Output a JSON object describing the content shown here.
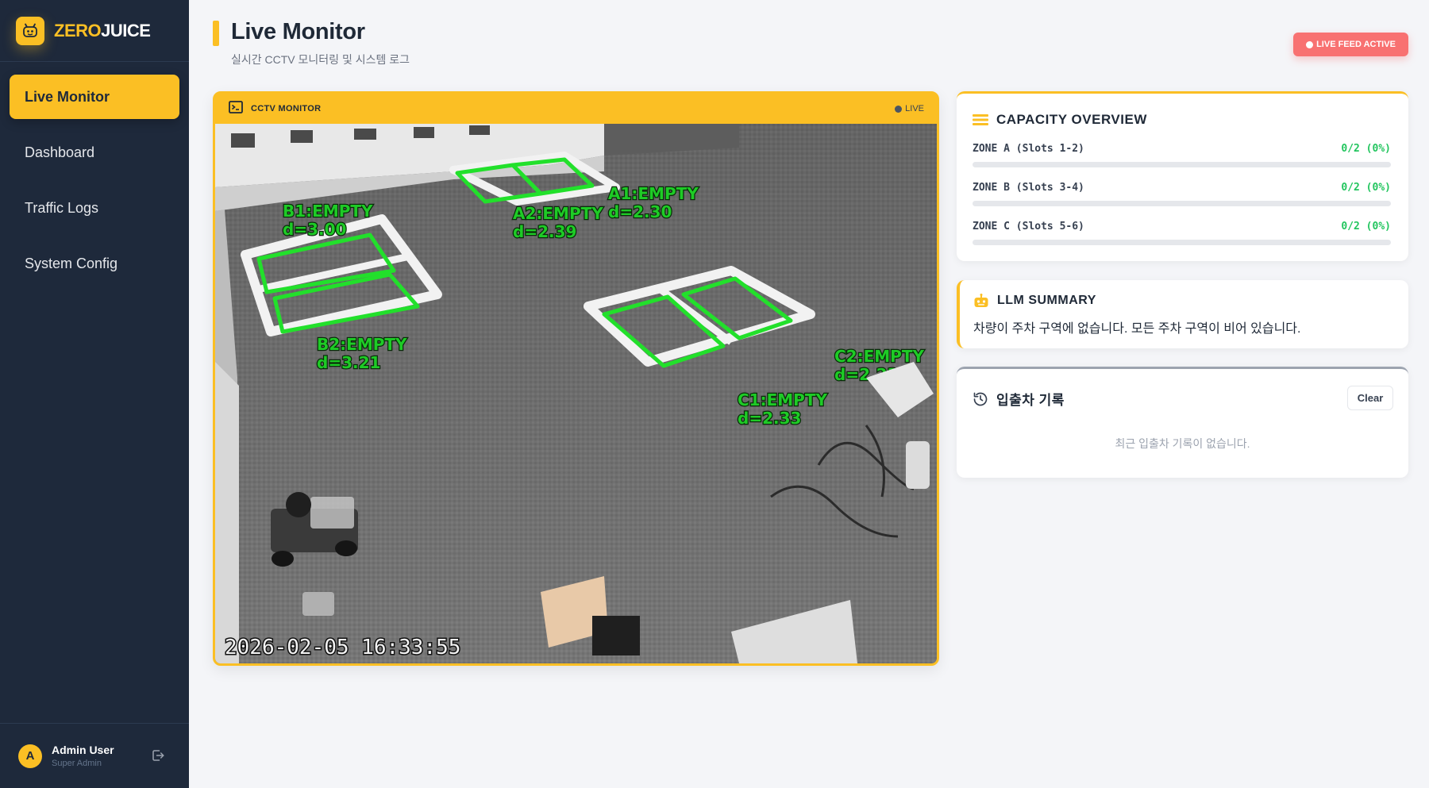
{
  "brand": {
    "part1": "ZERO",
    "part2": "JUICE"
  },
  "nav": [
    {
      "label": "Live Monitor",
      "active": true
    },
    {
      "label": "Dashboard",
      "active": false
    },
    {
      "label": "Traffic Logs",
      "active": false
    },
    {
      "label": "System Config",
      "active": false
    }
  ],
  "user": {
    "initial": "A",
    "name": "Admin User",
    "role": "Super Admin"
  },
  "header": {
    "title": "Live Monitor",
    "subtitle": "실시간 CCTV 모니터링 및 시스템 로그",
    "badge": "LIVE FEED ACTIVE"
  },
  "cctv": {
    "title": "CCTV MONITOR",
    "live": "LIVE",
    "timestamp": "2026-02-05 16:33:55",
    "slots": [
      {
        "label": "A1:EMPTY",
        "dist": "d=2.30"
      },
      {
        "label": "A2:EMPTY",
        "dist": "d=2.39"
      },
      {
        "label": "B1:EMPTY",
        "dist": "d=3.00"
      },
      {
        "label": "B2:EMPTY",
        "dist": "d=3.21"
      },
      {
        "label": "C1:EMPTY",
        "dist": "d=2.33"
      },
      {
        "label": "C2:EMPTY",
        "dist": "d=2.23"
      }
    ]
  },
  "capacity": {
    "title": "CAPACITY OVERVIEW",
    "zones": [
      {
        "name": "ZONE A (Slots 1-2)",
        "value": "0/2 (0%)",
        "fill": 0
      },
      {
        "name": "ZONE B (Slots 3-4)",
        "value": "0/2 (0%)",
        "fill": 0
      },
      {
        "name": "ZONE C (Slots 5-6)",
        "value": "0/2 (0%)",
        "fill": 0
      }
    ]
  },
  "llm": {
    "title": "LLM SUMMARY",
    "text": "차량이 주차 구역에 없습니다. 모든 주차 구역이 비어 있습니다."
  },
  "log": {
    "title": "입출차 기록",
    "clear_label": "Clear",
    "empty": "최근 입출차 기록이 없습니다."
  },
  "colors": {
    "accent": "#fbbf24",
    "sidebar": "#1e293b",
    "ok": "#22c55e",
    "alert": "#f87171"
  }
}
